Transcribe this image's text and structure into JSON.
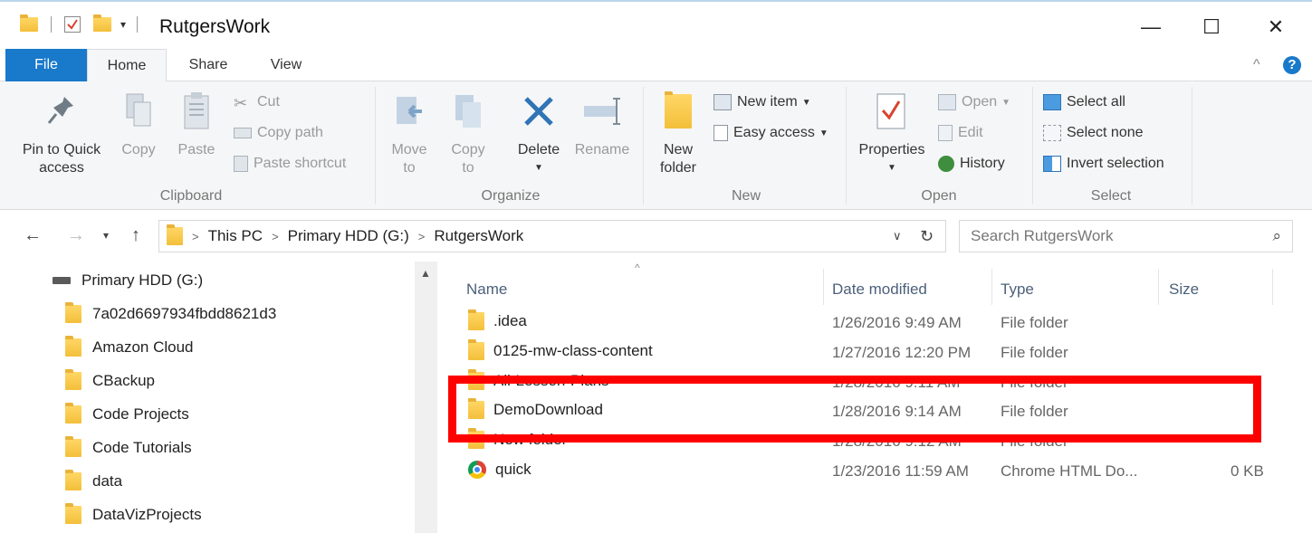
{
  "window": {
    "title": "RutgersWork",
    "minimize": "—",
    "maximize": "☐",
    "close": "✕"
  },
  "ribbon_tabs": {
    "file": "File",
    "home": "Home",
    "share": "Share",
    "view": "View",
    "help": "?"
  },
  "clipboard": {
    "pin": "Pin to Quick access",
    "copy": "Copy",
    "paste": "Paste",
    "cut": "Cut",
    "copy_path": "Copy path",
    "paste_shortcut": "Paste shortcut",
    "label": "Clipboard"
  },
  "organize": {
    "move_to": "Move to",
    "copy_to": "Copy to",
    "delete": "Delete",
    "rename": "Rename",
    "label": "Organize"
  },
  "new_group": {
    "new_folder": "New folder",
    "new_item": "New item",
    "easy_access": "Easy access",
    "label": "New"
  },
  "open_group": {
    "properties": "Properties",
    "open": "Open",
    "edit": "Edit",
    "history": "History",
    "label": "Open"
  },
  "select_group": {
    "select_all": "Select all",
    "select_none": "Select none",
    "invert": "Invert selection",
    "label": "Select"
  },
  "address": {
    "crumbs": [
      "This PC",
      "Primary HDD (G:)",
      "RutgersWork"
    ],
    "search_placeholder": "Search RutgersWork"
  },
  "nav_pane": {
    "items": [
      "Primary HDD (G:)",
      "7a02d6697934fbdd8621d3",
      "Amazon Cloud",
      "CBackup",
      "Code Projects",
      "Code Tutorials",
      "data",
      "DataVizProjects"
    ]
  },
  "columns": {
    "name": "Name",
    "date": "Date modified",
    "type": "Type",
    "size": "Size"
  },
  "files": [
    {
      "name": ".idea",
      "date": "1/26/2016 9:49 AM",
      "type": "File folder",
      "size": ""
    },
    {
      "name": "0125-mw-class-content",
      "date": "1/27/2016 12:20 PM",
      "type": "File folder",
      "size": ""
    },
    {
      "name": "All-Lesson-Plans",
      "date": "1/28/2016 9:11 AM",
      "type": "File folder",
      "size": ""
    },
    {
      "name": "DemoDownload",
      "date": "1/28/2016 9:14 AM",
      "type": "File folder",
      "size": ""
    },
    {
      "name": "New folder",
      "date": "1/28/2016 9:12 AM",
      "type": "File folder",
      "size": ""
    },
    {
      "name": "quick",
      "date": "1/23/2016 11:59 AM",
      "type": "Chrome HTML Do...",
      "size": "0 KB"
    }
  ],
  "colors": {
    "accent": "#1979ca",
    "highlight": "#ff0000",
    "folder": "#f3bf3a"
  }
}
